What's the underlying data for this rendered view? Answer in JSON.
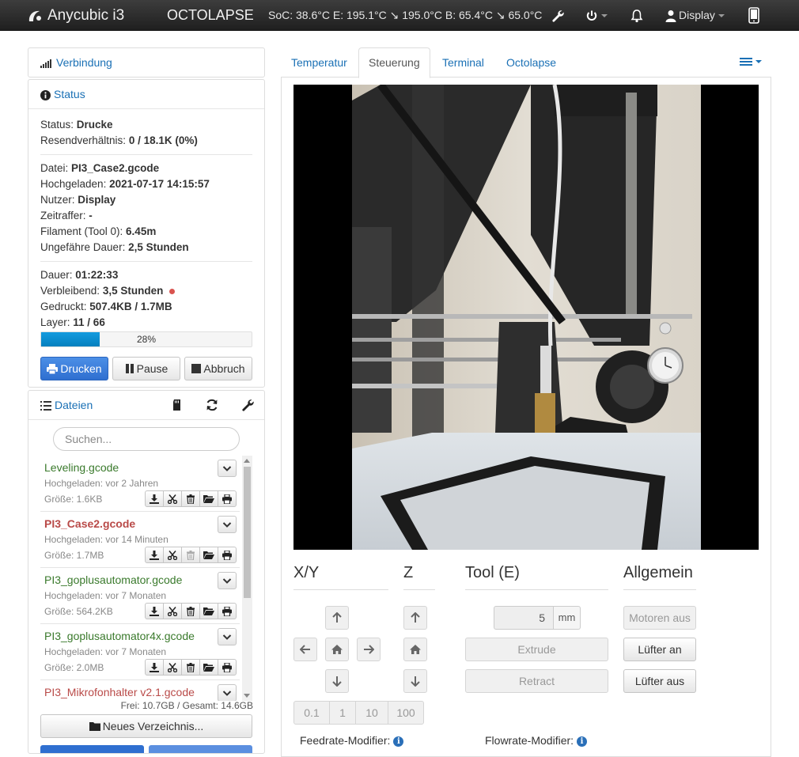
{
  "navbar": {
    "brand": "Anycubic i3",
    "title": "OCTOLAPSE",
    "temps": "SoC: 38.6°C E: 195.1°C ↘ 195.0°C B: 65.4°C ↘ 65.0°C",
    "user": "Display"
  },
  "sidebar": {
    "connection": {
      "title": "Verbindung"
    },
    "status": {
      "title": "Status",
      "rows": [
        {
          "label": "Status: ",
          "value": "Drucke"
        },
        {
          "label": "Resendverhältnis: ",
          "value": "0 / 18.1K (0%)"
        },
        {
          "label": "Datei: ",
          "value": "PI3_Case2.gcode"
        },
        {
          "label": "Hochgeladen: ",
          "value": "2021-07-17 14:15:57"
        },
        {
          "label": "Nutzer: ",
          "value": "Display"
        },
        {
          "label": "Zeitraffer: ",
          "value": "-"
        },
        {
          "label": "Filament (Tool 0): ",
          "value": "6.45m"
        },
        {
          "label": "Ungefähre Dauer: ",
          "value": "2,5 Stunden"
        },
        {
          "label": "Dauer: ",
          "value": "01:22:33"
        },
        {
          "label": "Verbleibend: ",
          "value": "3,5 Stunden"
        },
        {
          "label": "Gedruckt: ",
          "value": "507.4KB / 1.7MB"
        },
        {
          "label": "Layer: ",
          "value": "11 / 66"
        }
      ],
      "progress": {
        "text": "28%",
        "value": 0.28
      },
      "buttons": {
        "print": "Drucken",
        "pause": "Pause",
        "cancel": "Abbruch"
      }
    },
    "files": {
      "title": "Dateien",
      "search_placeholder": "Suchen...",
      "items": [
        {
          "name": "Leveling.gcode",
          "uploaded": "Hochgeladen: vor 2 Jahren",
          "size": "Größe: 1.6KB",
          "active": false
        },
        {
          "name": "PI3_Case2.gcode",
          "uploaded": "Hochgeladen: vor 14 Minuten",
          "size": "Größe: 1.7MB",
          "active": true
        },
        {
          "name": "PI3_goplusautomator.gcode",
          "uploaded": "Hochgeladen: vor 7 Monaten",
          "size": "Größe: 564.2KB",
          "active": false
        },
        {
          "name": "PI3_goplusautomator4x.gcode",
          "uploaded": "Hochgeladen: vor 7 Monaten",
          "size": "Größe: 2.0MB",
          "active": false
        },
        {
          "name": "PI3_Mikrofonhalter v2.1.gcode",
          "uploaded": "",
          "size": "",
          "active": false
        }
      ],
      "free": "Frei: 10.7GB / Gesamt: 14.6GB",
      "new_folder": "Neues Verzeichnis..."
    }
  },
  "tabs": [
    "Temperatur",
    "Steuerung",
    "Terminal",
    "Octolapse"
  ],
  "control": {
    "xy_title": "X/Y",
    "z_title": "Z",
    "tool_title": "Tool (E)",
    "general_title": "Allgemein",
    "steps": [
      "0.1",
      "1",
      "10",
      "100"
    ],
    "extrude_amount": "5",
    "extrude_unit": "mm",
    "extrude": "Extrude",
    "retract": "Retract",
    "motors_off": "Motoren aus",
    "fan_on": "Lüfter an",
    "fan_off": "Lüfter aus",
    "feedrate": "Feedrate-Modifier:",
    "flowrate": "Flowrate-Modifier:"
  },
  "colors": {
    "link": "#1a70b5",
    "primary": "#337ab7",
    "file_ok": "#3a7a2c",
    "file_active": "#b94a48"
  }
}
